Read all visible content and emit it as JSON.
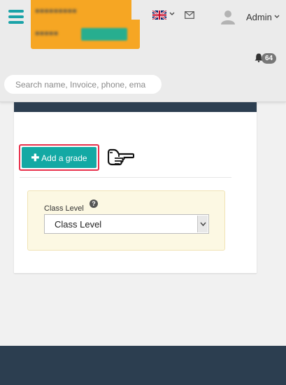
{
  "header": {
    "menu_icon": "hamburger-icon",
    "language_icon": "uk-flag-icon",
    "mail_icon": "envelope-icon",
    "avatar_icon": "user-avatar-icon",
    "user_name": "Admin",
    "user_chevron": "⌵",
    "notification_icon": "bell-icon",
    "notification_count": "64",
    "accent_color": "#1aa3a8"
  },
  "search": {
    "placeholder": "Search name, Invoice, phone, ema"
  },
  "content": {
    "add_button_label": "Add a grade",
    "add_button_icon": "plus-icon",
    "pointer_icon": "pointing-hand-icon",
    "filter": {
      "label": "Class Level",
      "help_icon": "question-circle-icon",
      "selected_value": "Class Level"
    }
  },
  "colors": {
    "primary_button": "#13a9a4",
    "highlight_border": "#e8304b",
    "header_dark": "#2c3e50",
    "filter_panel_bg": "#fcf8e3"
  }
}
